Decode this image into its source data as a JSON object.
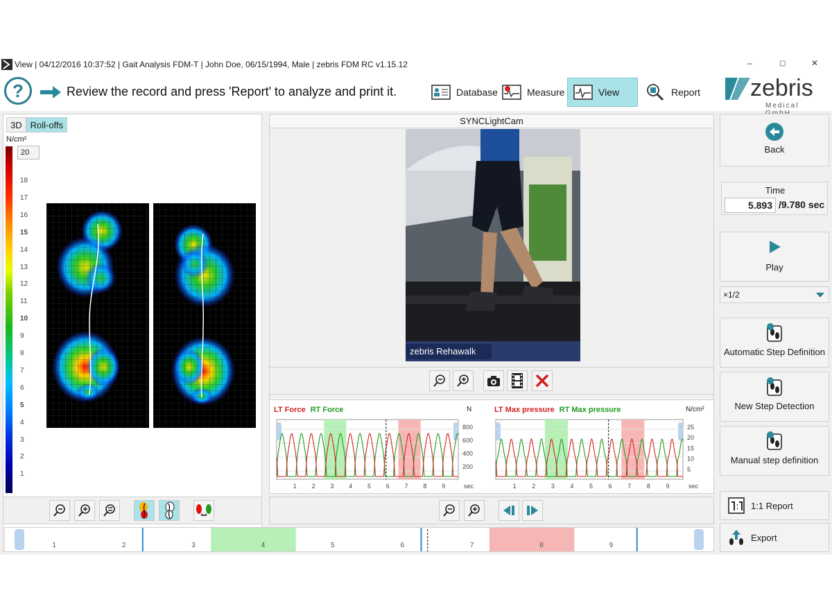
{
  "window": {
    "title": "View | 04/12/2016 10:37:52 | Gait Analysis FDM-T | John Doe, 06/15/1994, Male | zebris FDM RC v1.15.12",
    "minimize": "–",
    "restore": "▢",
    "close": "✕"
  },
  "toolbar": {
    "help": "?",
    "instruction": "Review the record and press 'Report' to analyze and print it.",
    "nav": [
      {
        "label": "Database",
        "icon": "database-icon",
        "active": false
      },
      {
        "label": "Measure",
        "icon": "measure-icon",
        "active": false
      },
      {
        "label": "View",
        "icon": "view-icon",
        "active": true
      },
      {
        "label": "Report",
        "icon": "report-icon",
        "active": false
      }
    ]
  },
  "brand": {
    "name": "zebris",
    "sub": "Medical GmbH",
    "color": "#2a8a9c"
  },
  "left_panel": {
    "tabs": [
      "3D",
      "Roll-offs"
    ],
    "active_tab": "Roll-offs",
    "scale_unit": "N/cm²",
    "scale_max": "20",
    "scale_ticks": [
      "18",
      "17",
      "16",
      "15",
      "14",
      "13",
      "12",
      "11",
      "10",
      "9",
      "8",
      "7",
      "6",
      "5",
      "4",
      "3",
      "2",
      "1"
    ],
    "scale_bold": [
      "15",
      "10",
      "5"
    ]
  },
  "camera": {
    "title": "SYNCLightCam",
    "overlay": "zebris Rehawalk"
  },
  "force_chart": {
    "legend_lt": "LT Force",
    "legend_rt": "RT Force",
    "unit": "N",
    "y_ticks": [
      "800",
      "600",
      "400",
      "200"
    ],
    "x_ticks": [
      "1",
      "2",
      "3",
      "4",
      "5",
      "6",
      "7",
      "8",
      "9"
    ],
    "x_unit": "sec",
    "lt_color": "#d42020",
    "rt_color": "#1f9a1f"
  },
  "pressure_chart": {
    "legend_lt": "LT Max pressure",
    "legend_rt": "RT Max pressure",
    "unit": "N/cm²",
    "y_ticks": [
      "25",
      "20",
      "15",
      "10",
      "5"
    ],
    "x_ticks": [
      "1",
      "2",
      "3",
      "4",
      "5",
      "6",
      "7",
      "8",
      "9"
    ],
    "x_unit": "sec"
  },
  "sidebar": {
    "back": "Back",
    "time_label": "Time",
    "time_current": "5.893",
    "time_total": "/9.780 sec",
    "play": "Play",
    "speed": "×1/2",
    "auto_step": "Automatic Step Definition",
    "new_step": "New Step Detection",
    "manual_step": "Manual step definition",
    "report_11": "1:1 Report",
    "export": "Export"
  },
  "timeline": {
    "labels": [
      "1",
      "2",
      "3",
      "4",
      "5",
      "6",
      "7",
      "8",
      "9"
    ],
    "current_time": 5.893,
    "total_time": 9.78,
    "green_range": [
      3,
      4
    ],
    "red_range": [
      7,
      8
    ]
  }
}
